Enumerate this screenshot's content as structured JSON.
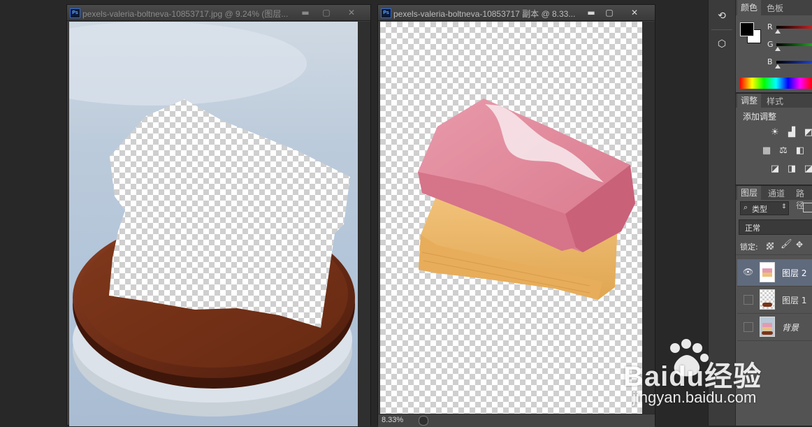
{
  "left_window": {
    "title": "pexels-valeria-boltneva-10853717.jpg @ 9.24% (图层...",
    "ps_badge": "Ps",
    "minimize": "▬",
    "maximize": "▢",
    "close": "✕"
  },
  "right_window": {
    "title": "pexels-valeria-boltneva-10853717 副本 @ 8.33...",
    "ps_badge": "Ps",
    "minimize": "▬",
    "maximize": "▢",
    "close": "✕",
    "zoom": "8.33%"
  },
  "color_panel": {
    "tabs": [
      "颜色",
      "色板"
    ],
    "channels": [
      {
        "label": "R",
        "color": "#c82020"
      },
      {
        "label": "G",
        "color": "#20a020"
      },
      {
        "label": "B",
        "color": "#2040c8"
      }
    ]
  },
  "adjust_panel": {
    "tabs": [
      "调整",
      "样式"
    ],
    "header": "添加调整"
  },
  "layers_panel": {
    "tabs": [
      "图层",
      "通道",
      "路径"
    ],
    "filter_label": "类型",
    "blend_mode": "正常",
    "lock_label": "锁定:",
    "layers": [
      {
        "name": "图层 2",
        "visible": true,
        "selected": true
      },
      {
        "name": "图层 1",
        "visible": false,
        "selected": false
      },
      {
        "name": "背景",
        "visible": false,
        "selected": false
      }
    ]
  },
  "watermark": {
    "brand": "Baidu经验",
    "url": "jingyan.baidu.com"
  }
}
